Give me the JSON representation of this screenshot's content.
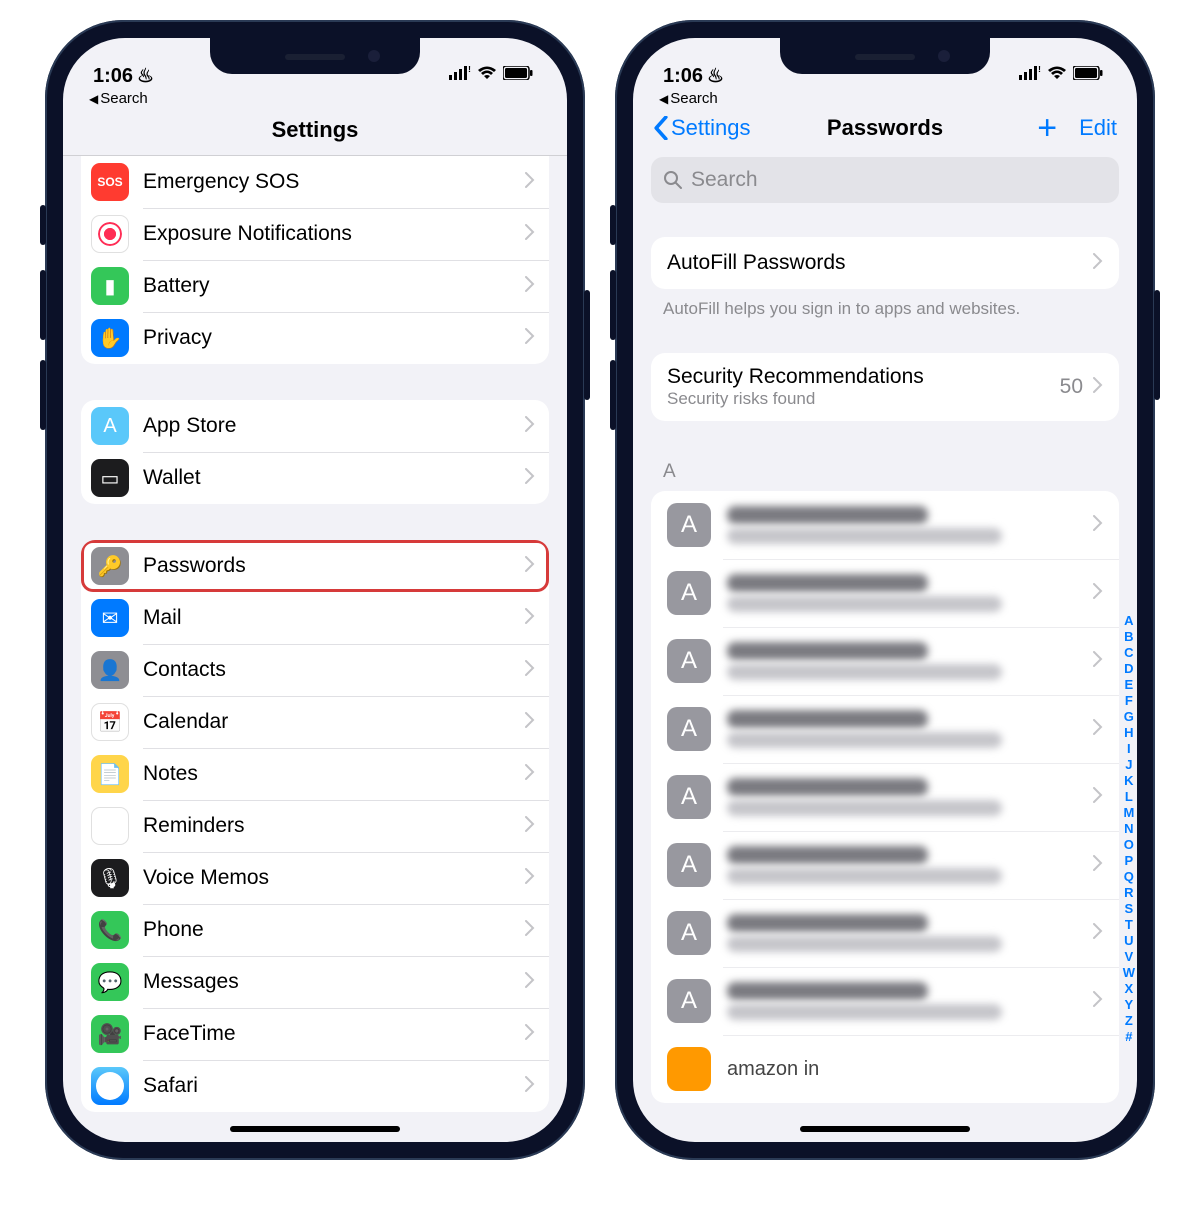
{
  "status": {
    "time": "1:06",
    "back_label": "Search"
  },
  "left_phone": {
    "title": "Settings",
    "groups": [
      [
        {
          "name": "emergency-sos",
          "label": "Emergency SOS",
          "icon_bg": "bg-red",
          "icon": "SOS"
        },
        {
          "name": "exposure-notifications",
          "label": "Exposure Notifications",
          "icon_bg": "bg-white exposure",
          "icon": ""
        },
        {
          "name": "battery",
          "label": "Battery",
          "icon_bg": "bg-green",
          "icon": "▮"
        },
        {
          "name": "privacy",
          "label": "Privacy",
          "icon_bg": "bg-blue",
          "icon": "✋"
        }
      ],
      [
        {
          "name": "app-store",
          "label": "App Store",
          "icon_bg": "bg-lightblue",
          "icon": "A"
        },
        {
          "name": "wallet",
          "label": "Wallet",
          "icon_bg": "bg-dark",
          "icon": "▭"
        }
      ],
      [
        {
          "name": "passwords",
          "label": "Passwords",
          "icon_bg": "bg-gray",
          "icon": "🔑",
          "highlighted": true
        },
        {
          "name": "mail",
          "label": "Mail",
          "icon_bg": "bg-blue",
          "icon": "✉"
        },
        {
          "name": "contacts",
          "label": "Contacts",
          "icon_bg": "bg-gray",
          "icon": "👤"
        },
        {
          "name": "calendar",
          "label": "Calendar",
          "icon_bg": "bg-white",
          "icon": "📅"
        },
        {
          "name": "notes",
          "label": "Notes",
          "icon_bg": "bg-yellow",
          "icon": "📄"
        },
        {
          "name": "reminders",
          "label": "Reminders",
          "icon_bg": "bg-white",
          "icon": "⋮"
        },
        {
          "name": "voice-memos",
          "label": "Voice Memos",
          "icon_bg": "bg-dark",
          "icon": "🎙"
        },
        {
          "name": "phone",
          "label": "Phone",
          "icon_bg": "bg-green",
          "icon": "📞"
        },
        {
          "name": "messages",
          "label": "Messages",
          "icon_bg": "bg-green",
          "icon": "💬"
        },
        {
          "name": "facetime",
          "label": "FaceTime",
          "icon_bg": "bg-green",
          "icon": "🎥"
        },
        {
          "name": "safari",
          "label": "Safari",
          "icon_bg": "safari-icon",
          "icon": ""
        }
      ]
    ]
  },
  "right_phone": {
    "back": "Settings",
    "title": "Passwords",
    "edit": "Edit",
    "search_placeholder": "Search",
    "autofill": {
      "label": "AutoFill Passwords",
      "footer": "AutoFill helps you sign in to apps and websites."
    },
    "security": {
      "label": "Security Recommendations",
      "sub": "Security risks found",
      "count": "50"
    },
    "section": "A",
    "entries": [
      {
        "letter": "A"
      },
      {
        "letter": "A"
      },
      {
        "letter": "A"
      },
      {
        "letter": "A"
      },
      {
        "letter": "A"
      },
      {
        "letter": "A"
      },
      {
        "letter": "A"
      },
      {
        "letter": "A"
      }
    ],
    "last_visible": "amazon in",
    "index": [
      "A",
      "B",
      "C",
      "D",
      "E",
      "F",
      "G",
      "H",
      "I",
      "J",
      "K",
      "L",
      "M",
      "N",
      "O",
      "P",
      "Q",
      "R",
      "S",
      "T",
      "U",
      "V",
      "W",
      "X",
      "Y",
      "Z",
      "#"
    ]
  }
}
